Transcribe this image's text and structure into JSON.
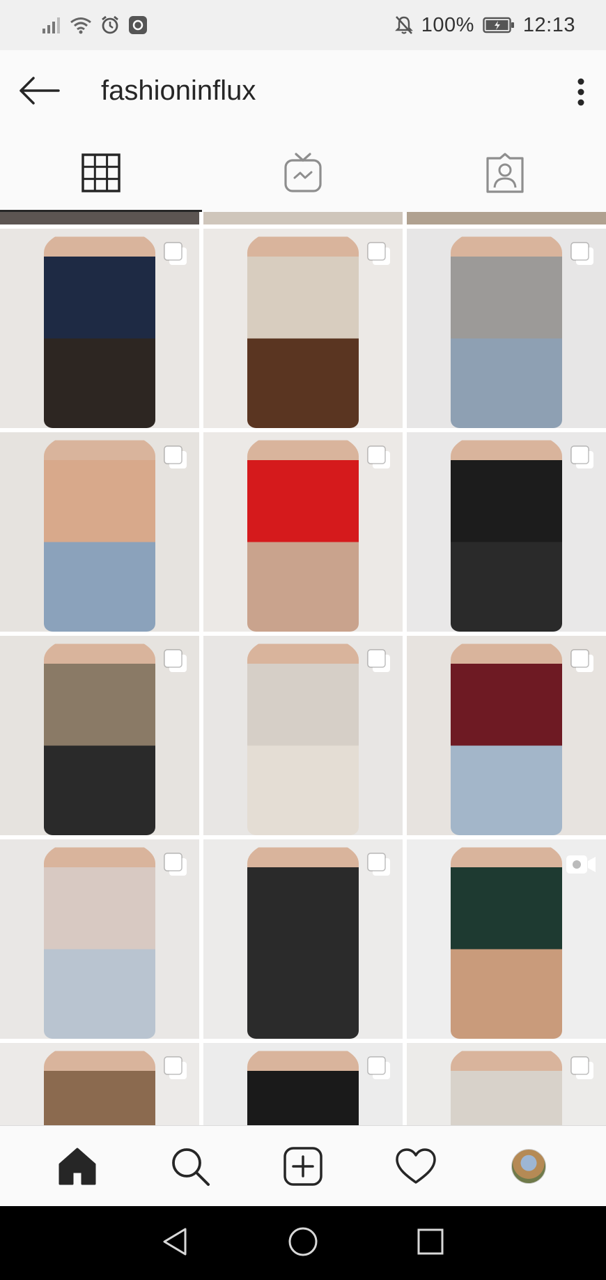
{
  "status_bar": {
    "battery": "100%",
    "time": "12:13",
    "icons": [
      "signal-icon",
      "wifi-icon",
      "alarm-icon",
      "screenshot-app-icon",
      "mute-bell-icon",
      "battery-icon"
    ]
  },
  "header": {
    "title": "fashioninflux",
    "back_icon": "back-arrow-icon",
    "more_icon": "more-vertical-icon"
  },
  "tabs": [
    {
      "name": "grid",
      "icon": "grid-icon",
      "active": true
    },
    {
      "name": "igtv",
      "icon": "igtv-icon",
      "active": false
    },
    {
      "name": "tagged",
      "icon": "tagged-person-icon",
      "active": false
    }
  ],
  "posts": [
    {
      "kind": "multi",
      "colors": [
        "#e9e6e3",
        "#1e2a44",
        "#2d2622"
      ]
    },
    {
      "kind": "multi",
      "colors": [
        "#ece9e6",
        "#d8cdbf",
        "#5a3521"
      ]
    },
    {
      "kind": "multi",
      "colors": [
        "#e7e6e6",
        "#9c9a98",
        "#8ea0b3"
      ]
    },
    {
      "kind": "multi",
      "colors": [
        "#e6e3df",
        "#d8a98b",
        "#8ba2bb"
      ]
    },
    {
      "kind": "multi",
      "colors": [
        "#ece9e6",
        "#d51a1c",
        "#c9a38d"
      ]
    },
    {
      "kind": "multi",
      "colors": [
        "#e9e8e8",
        "#1c1c1c",
        "#2a2a2a"
      ]
    },
    {
      "kind": "multi",
      "colors": [
        "#e6e3df",
        "#8a7a66",
        "#2a2a2a"
      ]
    },
    {
      "kind": "multi",
      "colors": [
        "#e8e6e4",
        "#d6cfc7",
        "#e4ddd4"
      ]
    },
    {
      "kind": "multi",
      "colors": [
        "#e7e3df",
        "#6e1a23",
        "#a3b6c9"
      ]
    },
    {
      "kind": "multi",
      "colors": [
        "#e9e7e5",
        "#d8c9c2",
        "#b9c4d0"
      ]
    },
    {
      "kind": "multi",
      "colors": [
        "#ecebea",
        "#2a2a2a",
        "#2b2b2b"
      ]
    },
    {
      "kind": "video",
      "colors": [
        "#eeeeee",
        "#1e3a31",
        "#c99b7b"
      ]
    },
    {
      "kind": "multi",
      "colors": [
        "#eceae8",
        "#8b6a4f",
        "#a7855f"
      ]
    },
    {
      "kind": "multi",
      "colors": [
        "#ececec",
        "#1a1a1a",
        "#2a2222"
      ]
    },
    {
      "kind": "multi",
      "colors": [
        "#ecebe9",
        "#d8d2ca",
        "#c4b59f"
      ]
    }
  ],
  "bottom_nav": [
    {
      "name": "home",
      "icon": "home-icon",
      "active": true
    },
    {
      "name": "search",
      "icon": "search-icon"
    },
    {
      "name": "new-post",
      "icon": "add-post-icon"
    },
    {
      "name": "activity",
      "icon": "heart-icon"
    },
    {
      "name": "profile",
      "icon": "profile-avatar"
    }
  ],
  "system_nav": [
    "back-triangle-icon",
    "home-circle-icon",
    "recents-square-icon"
  ]
}
